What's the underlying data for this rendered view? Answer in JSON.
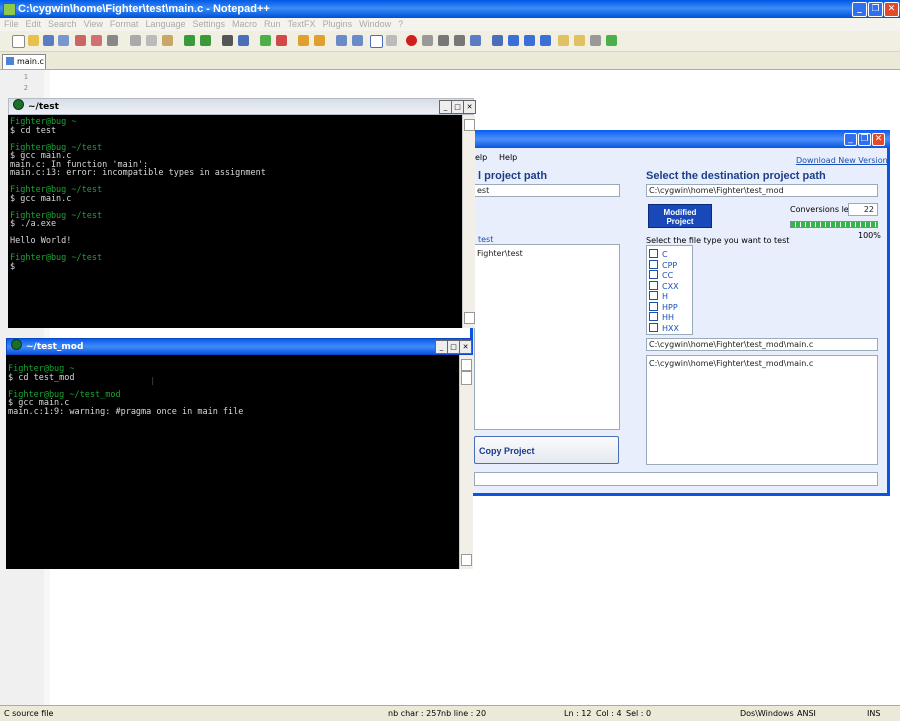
{
  "npp": {
    "title": "C:\\cygwin\\home\\Fighter\\test\\main.c - Notepad++",
    "menu": [
      "File",
      "Edit",
      "Search",
      "View",
      "Format",
      "Language",
      "Settings",
      "Macro",
      "Run",
      "TextFX",
      "Plugins",
      "Window",
      "?"
    ],
    "tab": "main.c",
    "lines": [
      "1",
      "2"
    ],
    "status": {
      "type": "C source file",
      "nbchar": "nb char : 257",
      "nbline": "nb line : 20",
      "ln": "Ln : 12",
      "col": "Col : 4",
      "sel": "Sel : 0",
      "eol": "Dos\\Windows",
      "enc": "ANSI",
      "ins": "INS"
    }
  },
  "copytool": {
    "menu_help": "Help",
    "menu_help_prefix": "elp",
    "download": "Download New Version",
    "src_heading": "l project path",
    "src_path": "est",
    "src_list_header": "test",
    "src_list_item": "Fighter\\test",
    "dst_heading": "Select the destination project path",
    "dst_path": "C:\\cygwin\\home\\Fighter\\test_mod",
    "modified_button": "Modified Project",
    "conversions_label": "Conversions left",
    "conversions_value": "22",
    "progress_pct": "100%",
    "progress_value": 1.0,
    "filetype_label": "Select the file type you want to test",
    "filetypes": [
      "C",
      "CPP",
      "CC",
      "CXX",
      "H",
      "HPP",
      "HH",
      "HXX"
    ],
    "file_path": "C:\\cygwin\\home\\Fighter\\test_mod\\main.c",
    "file_list_item": "C:\\cygwin\\home\\Fighter\\test_mod\\main.c",
    "copy_button": "Copy Project"
  },
  "term1": {
    "title": "~/test",
    "lines": [
      {
        "t": "Fighter@bug ~",
        "prompt": true
      },
      {
        "t": "$ cd test"
      },
      {
        "t": ""
      },
      {
        "t": "Fighter@bug ~/test",
        "prompt": true
      },
      {
        "t": "$ gcc main.c"
      },
      {
        "t": "main.c: In function 'main':"
      },
      {
        "t": "main.c:13: error: incompatible types in assignment"
      },
      {
        "t": ""
      },
      {
        "t": "Fighter@bug ~/test",
        "prompt": true
      },
      {
        "t": "$ gcc main.c"
      },
      {
        "t": ""
      },
      {
        "t": "Fighter@bug ~/test",
        "prompt": true
      },
      {
        "t": "$ ./a.exe"
      },
      {
        "t": ""
      },
      {
        "t": "Hello World!"
      },
      {
        "t": ""
      },
      {
        "t": "Fighter@bug ~/test",
        "prompt": true
      },
      {
        "t": "$"
      }
    ]
  },
  "term2": {
    "title": "~/test_mod",
    "lines": [
      {
        "t": "Fighter@bug ~",
        "prompt": true
      },
      {
        "t": "$ cd test_mod"
      },
      {
        "t": ""
      },
      {
        "t": "Fighter@bug ~/test_mod",
        "prompt": true
      },
      {
        "t": "$ gcc main.c"
      },
      {
        "t": "main.c:1:9: warning: #pragma once in main file"
      }
    ]
  },
  "colors": {
    "prompt": "#19a532",
    "title_blue": "#0a54e0",
    "heading": "#1a3f8a",
    "progress": "#36b34a"
  }
}
